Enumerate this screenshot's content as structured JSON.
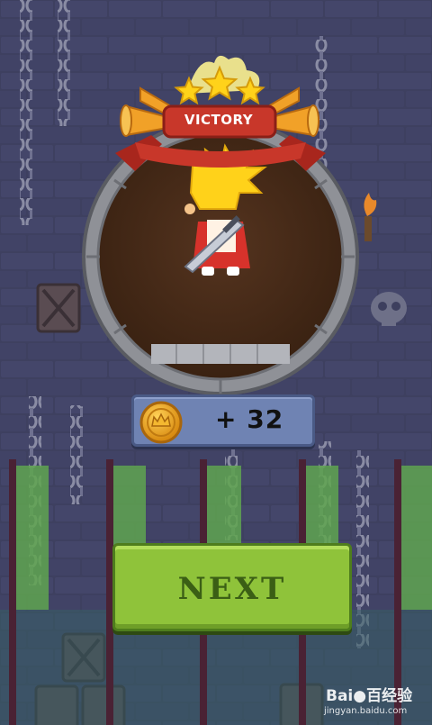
{
  "banner": {
    "title": "VICTORY",
    "stars_earned": 3,
    "stars_total": 3
  },
  "reward": {
    "amount_label": "+ 32",
    "icon": "crown-coin-icon"
  },
  "actions": {
    "next_label": "NEXT"
  },
  "watermark": {
    "brand": "Bai●百经验",
    "url": "jingyan.baidu.com"
  },
  "colors": {
    "background": "#3d3f5e",
    "banner_red": "#c8372a",
    "button_green": "#8fc33a",
    "button_text": "#3b5f15",
    "panel_blue": "#6f83b3",
    "coin_gold": "#e9a51e",
    "hero_hair": "#ffd21a",
    "hero_cape": "#d7322b"
  }
}
